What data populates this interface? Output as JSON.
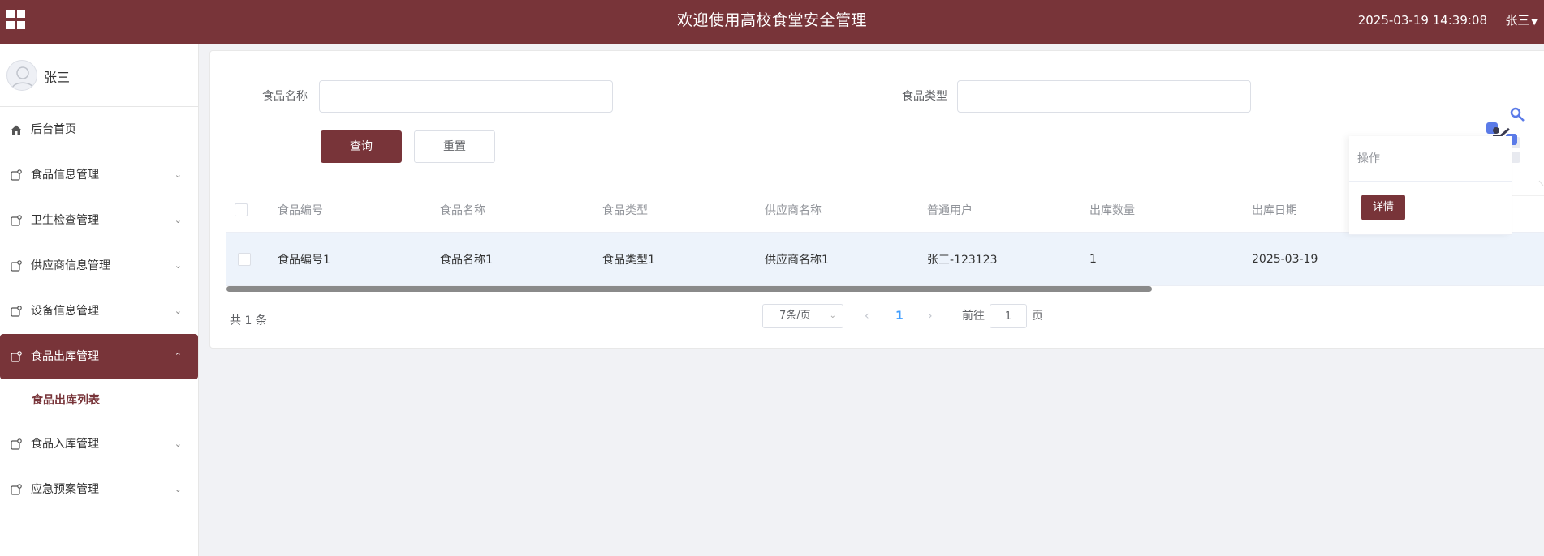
{
  "header": {
    "title": "欢迎使用高校食堂安全管理",
    "datetime": "2025-03-19 14:39:08",
    "user": "张三"
  },
  "sidebar": {
    "profile_name": "张三",
    "items": [
      {
        "label": "后台首页",
        "icon": "home-icon"
      },
      {
        "label": "食品信息管理",
        "icon": "module-icon"
      },
      {
        "label": "卫生检查管理",
        "icon": "module-icon"
      },
      {
        "label": "供应商信息管理",
        "icon": "module-icon"
      },
      {
        "label": "设备信息管理",
        "icon": "module-icon"
      },
      {
        "label": "食品出库管理",
        "icon": "module-icon",
        "active": true
      },
      {
        "label": "食品入库管理",
        "icon": "module-icon"
      },
      {
        "label": "应急预案管理",
        "icon": "module-icon"
      }
    ],
    "sub_item": "食品出库列表"
  },
  "search": {
    "food_name_label": "食品名称",
    "food_name_value": "",
    "food_type_label": "食品类型",
    "food_type_value": "",
    "query_label": "查询",
    "reset_label": "重置"
  },
  "table": {
    "columns": [
      "食品编号",
      "食品名称",
      "食品类型",
      "供应商名称",
      "普通用户",
      "出库数量",
      "出库日期"
    ],
    "operation_header": "操作",
    "rows": [
      {
        "cells": [
          "食品编号1",
          "食品名称1",
          "食品类型1",
          "供应商名称1",
          "张三-123123",
          "1",
          "2025-03-19"
        ],
        "action": "详情"
      }
    ]
  },
  "pagination": {
    "total": "共 1 条",
    "page_size": "7条/页",
    "current_page": "1",
    "goto_prefix": "前往",
    "goto_value": "1",
    "goto_suffix": "页"
  },
  "colors": {
    "brand": "#783439",
    "active_page": "#409eff",
    "row_highlight": "#edf3fb"
  }
}
